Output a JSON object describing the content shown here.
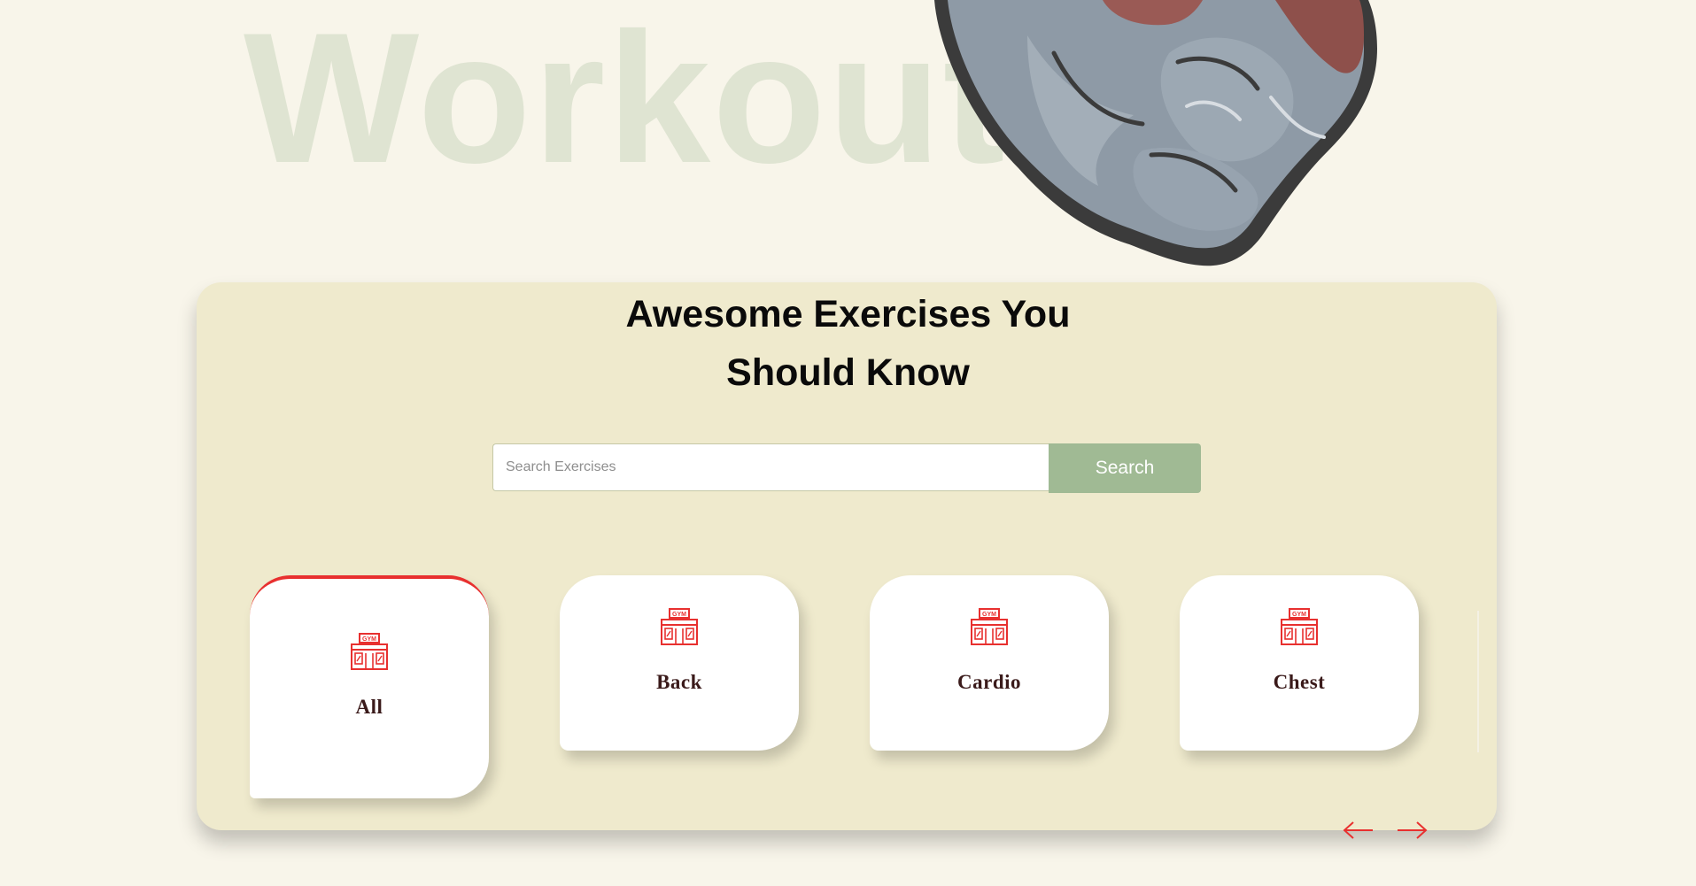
{
  "background": {
    "word": "Workout",
    "color": "#f8f5ea",
    "word_color": "#dfe4d2"
  },
  "hero": {
    "image": "flexed-bicep-illustration"
  },
  "section": {
    "title_line1": "Awesome Exercises You",
    "title_line2": "Should Know",
    "panel_color": "#efeacd"
  },
  "search": {
    "placeholder": "Search Exercises",
    "value": "",
    "button_label": "Search",
    "button_color": "#a0ba94",
    "search_icon": ""
  },
  "categories": {
    "accent_color": "#e8302f",
    "icon": "gym-building-icon",
    "items": [
      {
        "label": "All",
        "active": true
      },
      {
        "label": "Back",
        "active": false
      },
      {
        "label": "Cardio",
        "active": false
      },
      {
        "label": "Chest",
        "active": false
      }
    ]
  },
  "pagination": {
    "prev_icon": "arrow-left-icon",
    "next_icon": "arrow-right-icon",
    "color": "#e8302f"
  }
}
